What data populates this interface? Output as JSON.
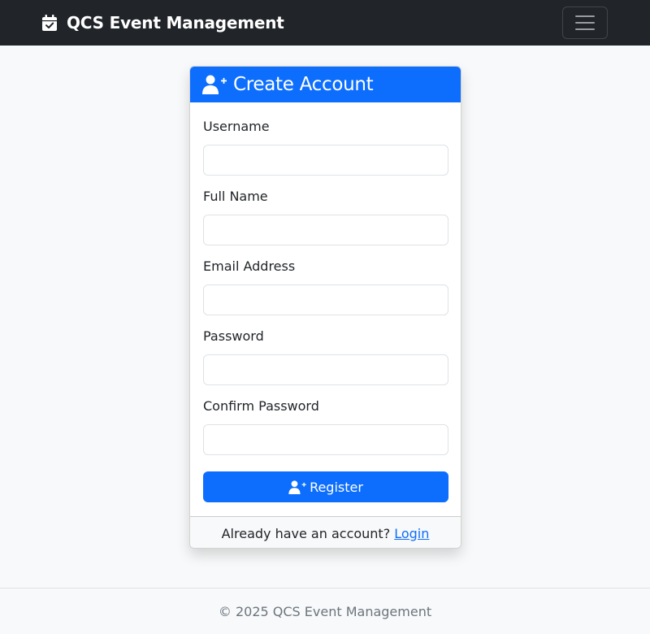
{
  "navbar": {
    "brand_text": "QCS Event Management",
    "brand_icon": "calendar-check-icon",
    "toggler_icon": "hamburger-menu-icon"
  },
  "card": {
    "header_title": "Create Account",
    "header_icon": "user-plus-icon",
    "fields": [
      {
        "label": "Username",
        "value": "",
        "placeholder": ""
      },
      {
        "label": "Full Name",
        "value": "",
        "placeholder": ""
      },
      {
        "label": "Email Address",
        "value": "",
        "placeholder": ""
      },
      {
        "label": "Password",
        "value": "",
        "placeholder": ""
      },
      {
        "label": "Confirm Password",
        "value": "",
        "placeholder": ""
      }
    ],
    "register_label": "Register",
    "register_icon": "user-plus-icon",
    "footer_text": "Already have an account?",
    "footer_link": "Login"
  },
  "footer": {
    "copyright": "© 2025 QCS Event Management"
  },
  "colors": {
    "navbar_bg": "#212529",
    "primary": "#0d6efd",
    "page_bg": "#f8f9fa"
  }
}
